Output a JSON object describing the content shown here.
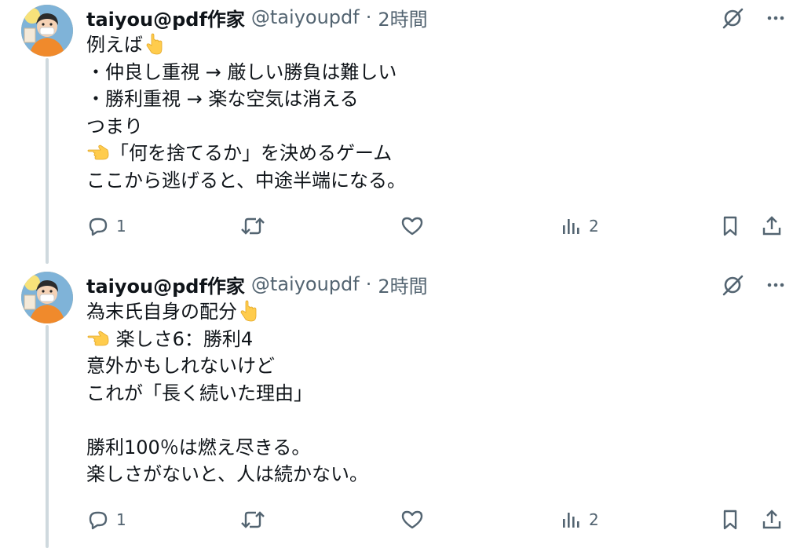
{
  "tweets": [
    {
      "author": {
        "display_name": "taiyou@pdf作家",
        "handle": "@taiyoupdf",
        "separator": "·",
        "time": "2時間"
      },
      "lines": [
        {
          "pre": "例えば",
          "emoji": "point-down",
          "post": ""
        },
        {
          "pre": "",
          "emoji": "",
          "post": "・仲良し重視 → 厳しい勝負は難しい"
        },
        {
          "pre": "",
          "emoji": "",
          "post": "・勝利重視 → 楽な空気は消える"
        },
        {
          "pre": "",
          "emoji": "",
          "post": "つまり"
        },
        {
          "pre": "",
          "emoji": "point-right",
          "post": "「何を捨てるか」を決めるゲーム"
        },
        {
          "pre": "",
          "emoji": "",
          "post": "ここから逃げると、中途半端になる。"
        }
      ],
      "actions": {
        "reply_count": "1",
        "retweet_count": "",
        "like_count": "",
        "views_count": "2"
      }
    },
    {
      "author": {
        "display_name": "taiyou@pdf作家",
        "handle": "@taiyoupdf",
        "separator": "·",
        "time": "2時間"
      },
      "lines": [
        {
          "pre": "為末氏自身の配分",
          "emoji": "point-down",
          "post": ""
        },
        {
          "pre": "",
          "emoji": "point-right",
          "post": " 楽しさ6：勝利4"
        },
        {
          "pre": "",
          "emoji": "",
          "post": "意外かもしれないけど"
        },
        {
          "pre": "",
          "emoji": "",
          "post": "これが「長く続いた理由」"
        },
        {
          "pre": "",
          "emoji": "",
          "post": ""
        },
        {
          "pre": "",
          "emoji": "",
          "post": "勝利100％は燃え尽きる。"
        },
        {
          "pre": "",
          "emoji": "",
          "post": "楽しさがないと、人は続かない。"
        }
      ],
      "actions": {
        "reply_count": "1",
        "retweet_count": "",
        "like_count": "",
        "views_count": "2"
      }
    }
  ],
  "icons": {
    "grok": "grok-icon",
    "more": "more-icon",
    "reply": "reply-icon",
    "retweet": "retweet-icon",
    "like": "like-icon",
    "views": "views-icon",
    "bookmark": "bookmark-icon",
    "share": "share-icon",
    "emoji_point_down": "point-down-emoji",
    "emoji_point_right": "point-right-emoji"
  },
  "colors": {
    "text": "#0f1419",
    "secondary": "#536471",
    "thread_line": "#cfd9de",
    "emoji": "#ffcc4d"
  }
}
